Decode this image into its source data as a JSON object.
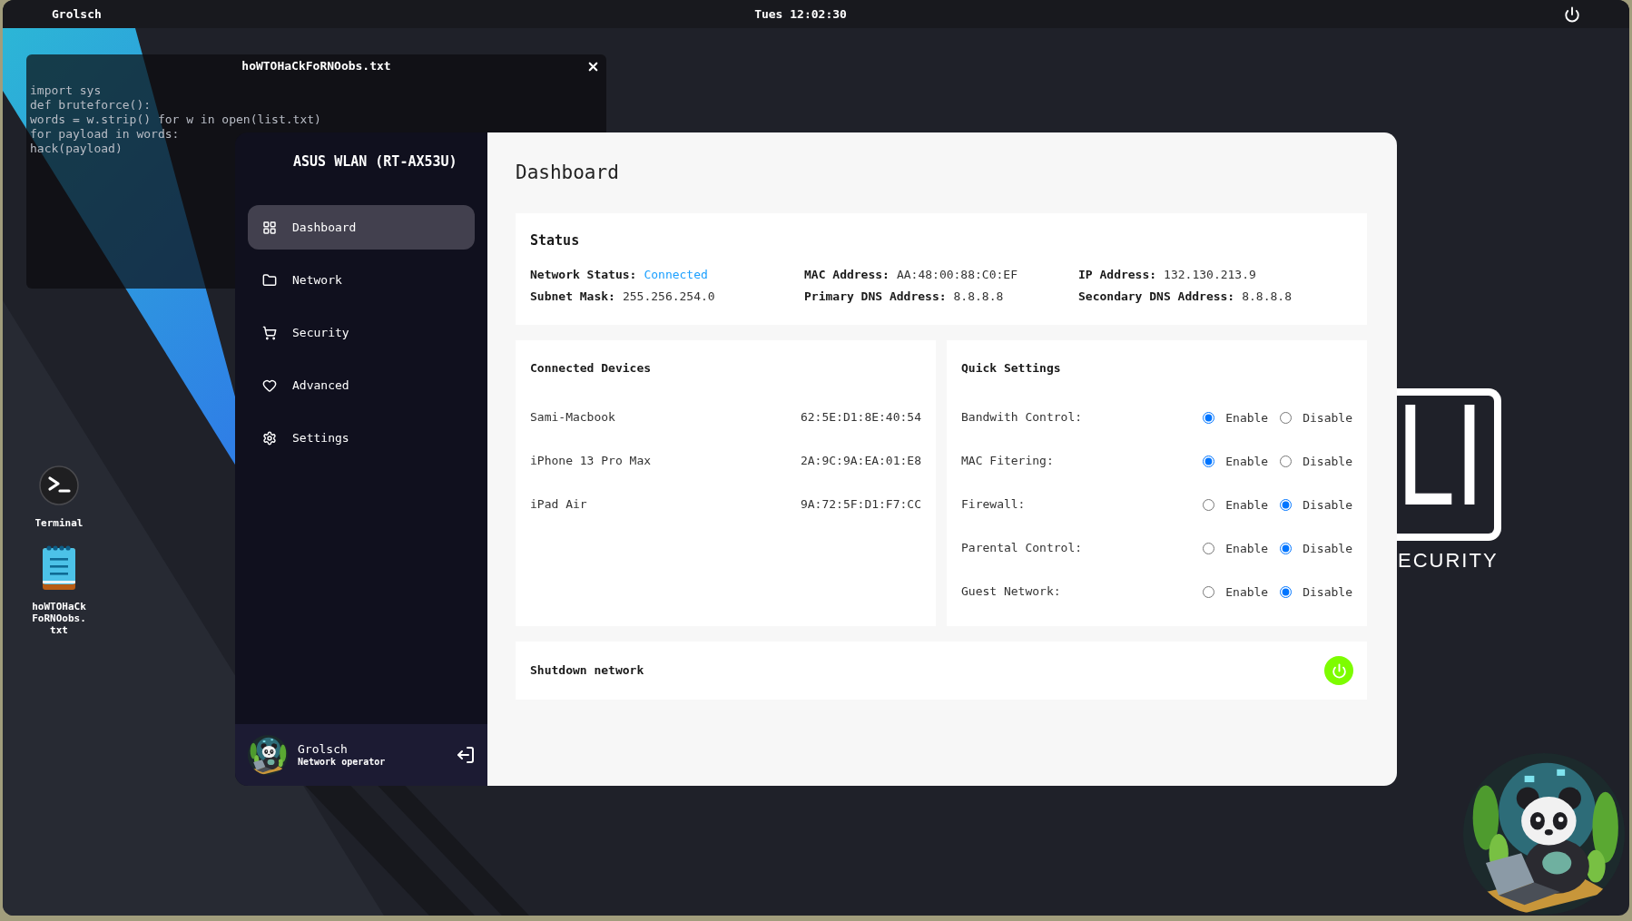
{
  "top_bar": {
    "user": "Grolsch",
    "clock": "Tues 12:02:30"
  },
  "editor_window": {
    "title": "hoWTOHaCkFoRNOobs.txt",
    "lines": [
      "import sys",
      "def bruteforce():",
      "words = w.strip() for w in open(list.txt)",
      "for payload in words:",
      "hack(payload)"
    ]
  },
  "router_window": {
    "sidebar": {
      "title": "ASUS WLAN (RT-AX53U)",
      "items": [
        {
          "label": "Dashboard",
          "kind": "grid",
          "selected": true
        },
        {
          "label": "Network",
          "kind": "folder",
          "selected": false
        },
        {
          "label": "Security",
          "kind": "cart",
          "selected": false
        },
        {
          "label": "Advanced",
          "kind": "heart",
          "selected": false
        },
        {
          "label": "Settings",
          "kind": "gear",
          "selected": false
        }
      ],
      "user": {
        "name": "Grolsch",
        "role": "Network operator"
      }
    },
    "page_title": "Dashboard",
    "status": {
      "title": "Status",
      "fields": [
        {
          "label": "Network Status:",
          "value": "Connected",
          "kind": "status"
        },
        {
          "label": "MAC Address:",
          "value": "AA:48:00:88:C0:EF",
          "kind": "text"
        },
        {
          "label": "IP Address:",
          "value": "132.130.213.9",
          "kind": "text"
        },
        {
          "label": "Subnet Mask:",
          "value": "255.256.254.0",
          "kind": "text"
        },
        {
          "label": "Primary DNS Address:",
          "value": "8.8.8.8",
          "kind": "text"
        },
        {
          "label": "Secondary DNS Address:",
          "value": "8.8.8.8",
          "kind": "text"
        }
      ]
    },
    "connected_devices": {
      "title": "Connected Devices",
      "devices": [
        {
          "name": "Sami-Macbook",
          "mac": "62:5E:D1:8E:40:54"
        },
        {
          "name": "iPhone 13 Pro Max",
          "mac": "2A:9C:9A:EA:01:E8"
        },
        {
          "name": "iPad Air",
          "mac": "9A:72:5F:D1:F7:CC"
        }
      ]
    },
    "quick_settings": {
      "title": "Quick Settings",
      "items": [
        {
          "label": "Bandwith Control:",
          "options": [
            {
              "label": "Enable",
              "selected": true
            },
            {
              "label": "Disable",
              "selected": false
            }
          ]
        },
        {
          "label": "MAC Fitering:",
          "options": [
            {
              "label": "Enable",
              "selected": true
            },
            {
              "label": "Disable",
              "selected": false
            }
          ]
        },
        {
          "label": "Firewall:",
          "options": [
            {
              "label": "Enable",
              "selected": false
            },
            {
              "label": "Disable",
              "selected": true
            }
          ]
        },
        {
          "label": "Parental Control:",
          "options": [
            {
              "label": "Enable",
              "selected": false
            },
            {
              "label": "Disable",
              "selected": true
            }
          ]
        },
        {
          "label": "Guest Network:",
          "options": [
            {
              "label": "Enable",
              "selected": false
            },
            {
              "label": "Disable",
              "selected": true
            }
          ]
        }
      ]
    },
    "shutdown": {
      "label": "Shutdown network"
    }
  },
  "desktop_icons": [
    {
      "kind": "terminal",
      "label": "Terminal"
    },
    {
      "kind": "text_file",
      "label": "hoWTOHaCkFoRNOobs.txt"
    }
  ],
  "wallpaper_logo": {
    "letters": "LI",
    "caption": "ECURITY"
  }
}
